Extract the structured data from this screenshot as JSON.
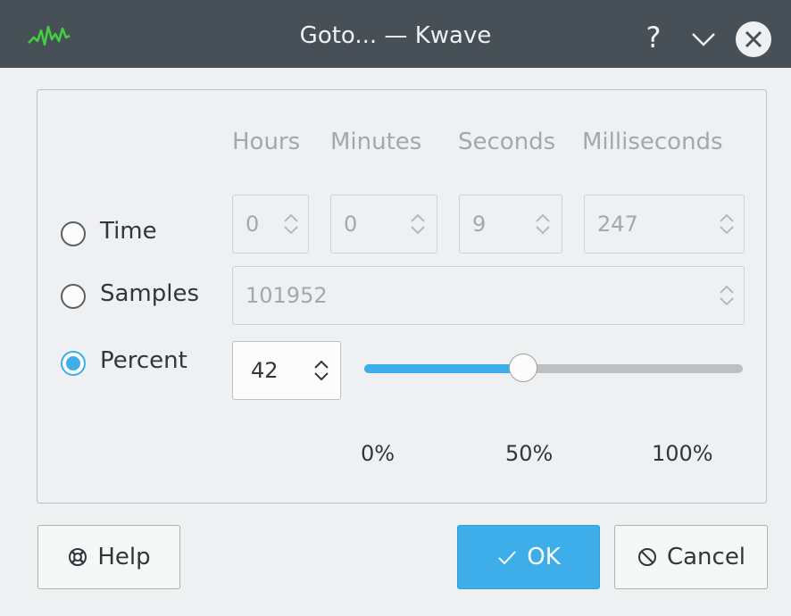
{
  "window": {
    "title": "Goto... — Kwave",
    "help_glyph": "?"
  },
  "columns": {
    "hours": "Hours",
    "minutes": "Minutes",
    "seconds": "Seconds",
    "milliseconds": "Milliseconds"
  },
  "modes": {
    "time": {
      "label": "Time",
      "checked": false
    },
    "samples": {
      "label": "Samples",
      "checked": false
    },
    "percent": {
      "label": "Percent",
      "checked": true
    }
  },
  "time": {
    "hours": "0",
    "minutes": "0",
    "seconds": "9",
    "milliseconds": "247"
  },
  "samples": {
    "value": "101952"
  },
  "percent": {
    "value": "42",
    "slider_value": 42,
    "slider_min": 0,
    "slider_max": 100,
    "tick_labels": [
      "0%",
      "50%",
      "100%"
    ]
  },
  "buttons": {
    "help": "Help",
    "ok": "OK",
    "cancel": "Cancel"
  },
  "colors": {
    "accent": "#3daee9",
    "titlebar": "#475057",
    "background": "#eff0f1",
    "app_icon": "#3fd13f"
  }
}
